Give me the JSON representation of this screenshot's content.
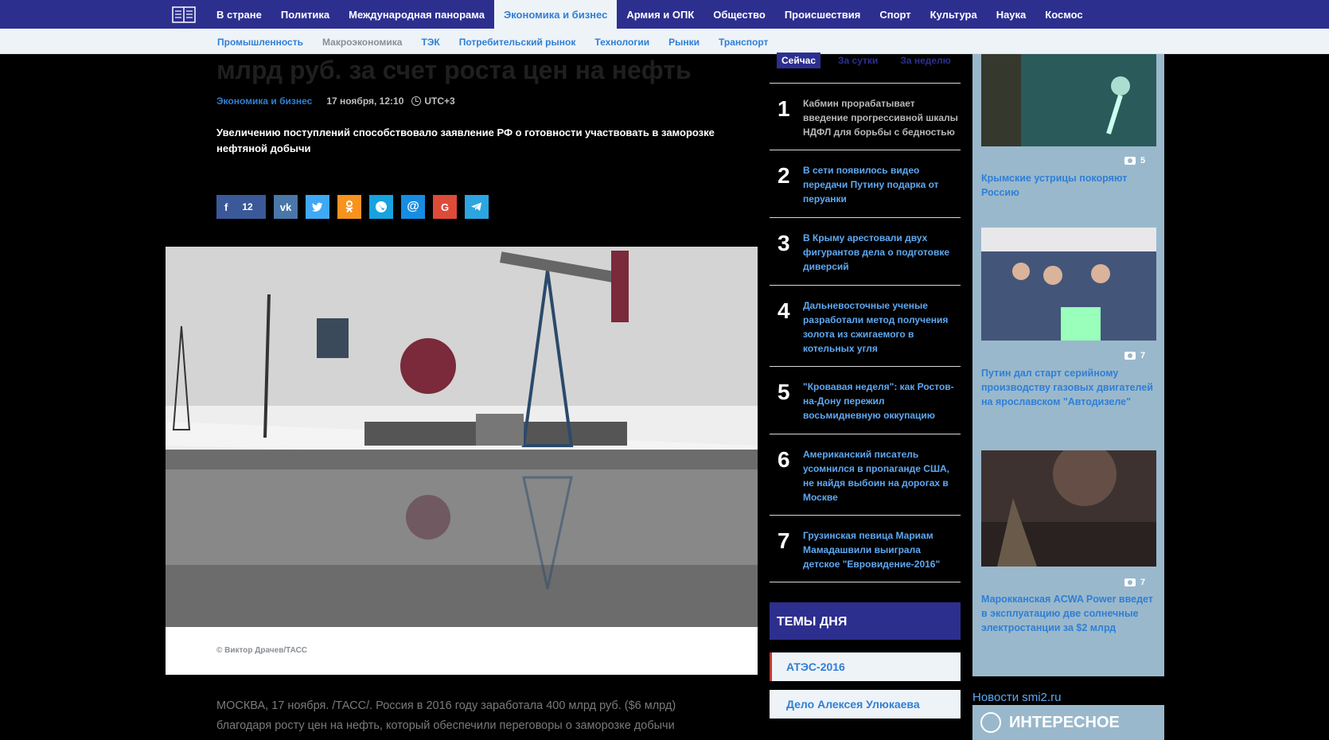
{
  "nav": {
    "items": [
      "В стране",
      "Политика",
      "Международная панорама",
      "Экономика и бизнес",
      "Армия и ОПК",
      "Общество",
      "Происшествия",
      "Спорт",
      "Культура",
      "Наука",
      "Космос"
    ],
    "active_index": 3
  },
  "subnav": {
    "items": [
      "Промышленность",
      "Макроэкономика",
      "ТЭК",
      "Потребительский рынок",
      "Технологии",
      "Рынки",
      "Транспорт"
    ],
    "muted_index": 1
  },
  "article": {
    "headline": "млрд руб. за счет роста цен на нефть",
    "rubric": "Экономика и бизнес",
    "date": "17 ноября, 12:10",
    "timezone": "UTC+3",
    "lead": "Увеличению поступлений способствовало заявление РФ о готовности участвовать в заморозке нефтяной добычи",
    "share": {
      "fb_count": "12",
      "buttons": [
        "vk-icon",
        "twitter-icon",
        "odnoklassniki-icon",
        "livejournal-icon",
        "mail-icon",
        "google-plus-icon",
        "telegram-icon"
      ]
    },
    "photo_credit": "© Виктор Драчев/ТАСС",
    "body": "МОСКВА, 17 ноября. /ТАСС/. Россия в 2016 году заработала 400 млрд руб. ($6 млрд) благодаря росту цен на нефть, который обеспечили переговоры о заморозке добычи"
  },
  "popular": {
    "tabs": [
      "Сейчас",
      "За сутки",
      "За неделю"
    ],
    "items": [
      {
        "num": "1",
        "text": "Кабмин прорабатывает введение прогрессивной шкалы НДФЛ для борьбы с бедностью"
      },
      {
        "num": "2",
        "text": "В сети появилось видео передачи Путину подарка от перуанки"
      },
      {
        "num": "3",
        "text": "В Крыму арестовали двух фигурантов дела о подготовке диверсий"
      },
      {
        "num": "4",
        "text": "Дальневосточные ученые разработали метод получения золота из сжигаемого в котельных угля"
      },
      {
        "num": "5",
        "text": "\"Кровавая неделя\": как Ростов-на-Дону пережил восьмидневную оккупацию"
      },
      {
        "num": "6",
        "text": "Американский писатель усомнился в пропаганде США, не найдя выбоин на дорогах в Москве"
      },
      {
        "num": "7",
        "text": "Грузинская певица Мариам Мамадашвили выиграла детское \"Евровидение-2016\""
      }
    ]
  },
  "themes": {
    "title": "ТЕМЫ ДНЯ",
    "items": [
      "АТЭС-2016",
      "Дело Алексея Улюкаева"
    ]
  },
  "photos": [
    {
      "count": "5",
      "title": "Крымские устрицы покоряют Россию"
    },
    {
      "count": "7",
      "title": "Путин дал старт серийному производству газовых двигателей на ярославском \"Автодизеле\""
    },
    {
      "count": "7",
      "title": "Марокканская ACWA Power введет в эксплуатацию две солнечные электростанции за $2 млрд"
    }
  ],
  "sidebar_footer": {
    "smi2": "Новости smi2.ru",
    "interesting": "ИНТЕРЕСНОЕ"
  }
}
